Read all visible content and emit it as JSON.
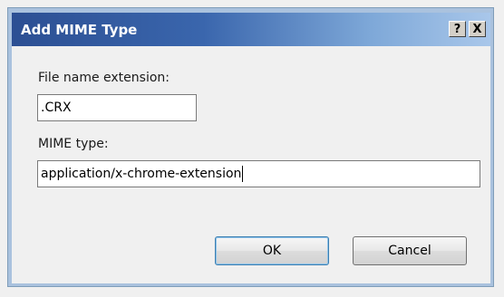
{
  "dialog": {
    "title": "Add MIME Type",
    "help_label": "?",
    "close_label": "X",
    "extension_label": "File name extension:",
    "extension_value": ".CRX",
    "mime_label": "MIME type:",
    "mime_value": "application/x-chrome-extension",
    "ok_label": "OK",
    "cancel_label": "Cancel"
  },
  "colors": {
    "titlebar_start": "#2c4f93",
    "titlebar_end": "#a9c7ea",
    "window_frame": "#aac2de",
    "client_bg": "#f0f0f0"
  }
}
